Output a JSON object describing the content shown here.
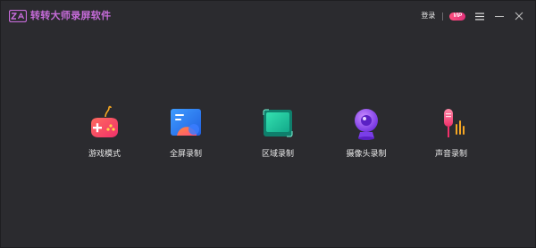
{
  "app": {
    "title": "转转大师录屏软件",
    "logo_text": "ZA"
  },
  "titlebar": {
    "login_label": "登录",
    "vip_label": "VIP",
    "menu_icon": "menu-icon",
    "minimize_icon": "minimize-icon",
    "close_icon": "close-icon"
  },
  "features": [
    {
      "label": "游戏模式",
      "icon": "gamepad-icon"
    },
    {
      "label": "全屏录制",
      "icon": "fullscreen-icon"
    },
    {
      "label": "区域录制",
      "icon": "region-icon"
    },
    {
      "label": "摄像头录制",
      "icon": "webcam-icon"
    },
    {
      "label": "声音录制",
      "icon": "microphone-icon"
    }
  ],
  "colors": {
    "background": "#2b2b2f",
    "brand": "#c56bd8",
    "vip": "#ff4f7e",
    "text": "#e8e8e8"
  }
}
